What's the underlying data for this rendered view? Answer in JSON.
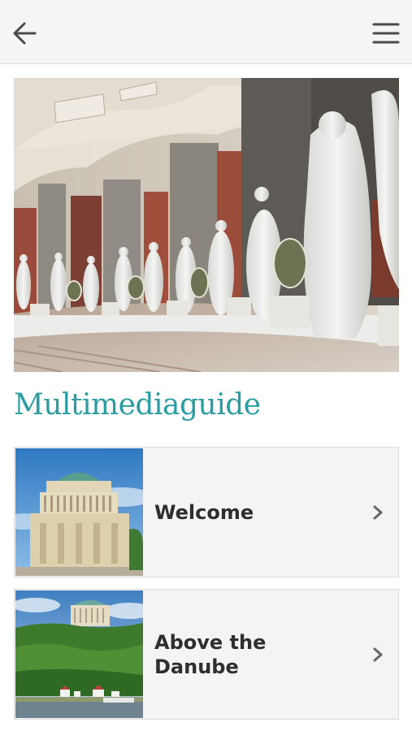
{
  "header": {
    "back_icon": "arrow-left-icon",
    "menu_icon": "hamburger-menu-icon",
    "background": "#f5f5f5"
  },
  "hero": {
    "image_subject": "marble-victory-statues-in-rotunda"
  },
  "main": {
    "title": "Multimediaguide",
    "title_color": "#2a9da3",
    "items": [
      {
        "label": "Welcome",
        "thumbnail": "rotunda-building-photo",
        "chevron_icon": "chevron-right-icon"
      },
      {
        "label": "Above the\nDanube",
        "thumbnail": "building-above-river-photo",
        "chevron_icon": "chevron-right-icon"
      }
    ]
  }
}
